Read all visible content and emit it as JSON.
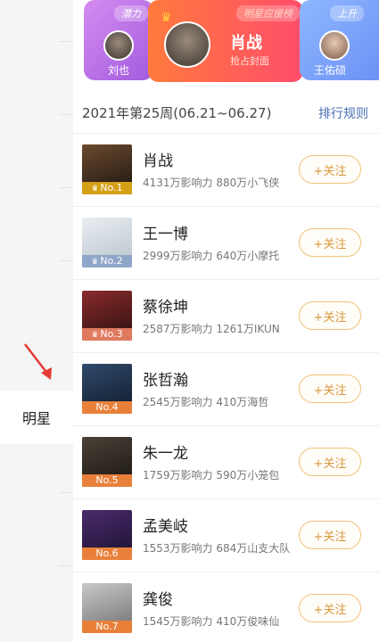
{
  "colors": {
    "accent": "#d9963a",
    "link": "#4a6fb5",
    "badge_gold": "#d4a017",
    "badge_silver": "#8fa6c8",
    "badge_bronze": "#e07a5f",
    "badge_default": "#e8803a"
  },
  "sidebar": {
    "active_tab": "明星"
  },
  "banner": {
    "cards": [
      {
        "tag": "潜力",
        "name": "刘也"
      },
      {
        "tag": "明星应援榜",
        "name": "肖战",
        "sub": "抢占封面"
      },
      {
        "tag": "上升",
        "name": "王佑硕"
      }
    ]
  },
  "period": {
    "text": "2021年第25周(06.21~06.27)",
    "rules_label": "排行规则"
  },
  "list": [
    {
      "rank": "No.1",
      "name": "肖战",
      "stats": "4131万影响力 880万小飞侠",
      "follow": "+关注",
      "has_crown": true
    },
    {
      "rank": "No.2",
      "name": "王一博",
      "stats": "2999万影响力 640万小摩托",
      "follow": "+关注",
      "has_crown": true
    },
    {
      "rank": "No.3",
      "name": "蔡徐坤",
      "stats": "2587万影响力 1261万IKUN",
      "follow": "+关注",
      "has_crown": true
    },
    {
      "rank": "No.4",
      "name": "张哲瀚",
      "stats": "2545万影响力 410万海哲",
      "follow": "+关注",
      "has_crown": false
    },
    {
      "rank": "No.5",
      "name": "朱一龙",
      "stats": "1759万影响力 590万小笼包",
      "follow": "+关注",
      "has_crown": false
    },
    {
      "rank": "No.6",
      "name": "孟美岐",
      "stats": "1553万影响力 684万山支大队",
      "follow": "+关注",
      "has_crown": false
    },
    {
      "rank": "No.7",
      "name": "龚俊",
      "stats": "1545万影响力 410万俊味仙",
      "follow": "+关注",
      "has_crown": false
    }
  ]
}
